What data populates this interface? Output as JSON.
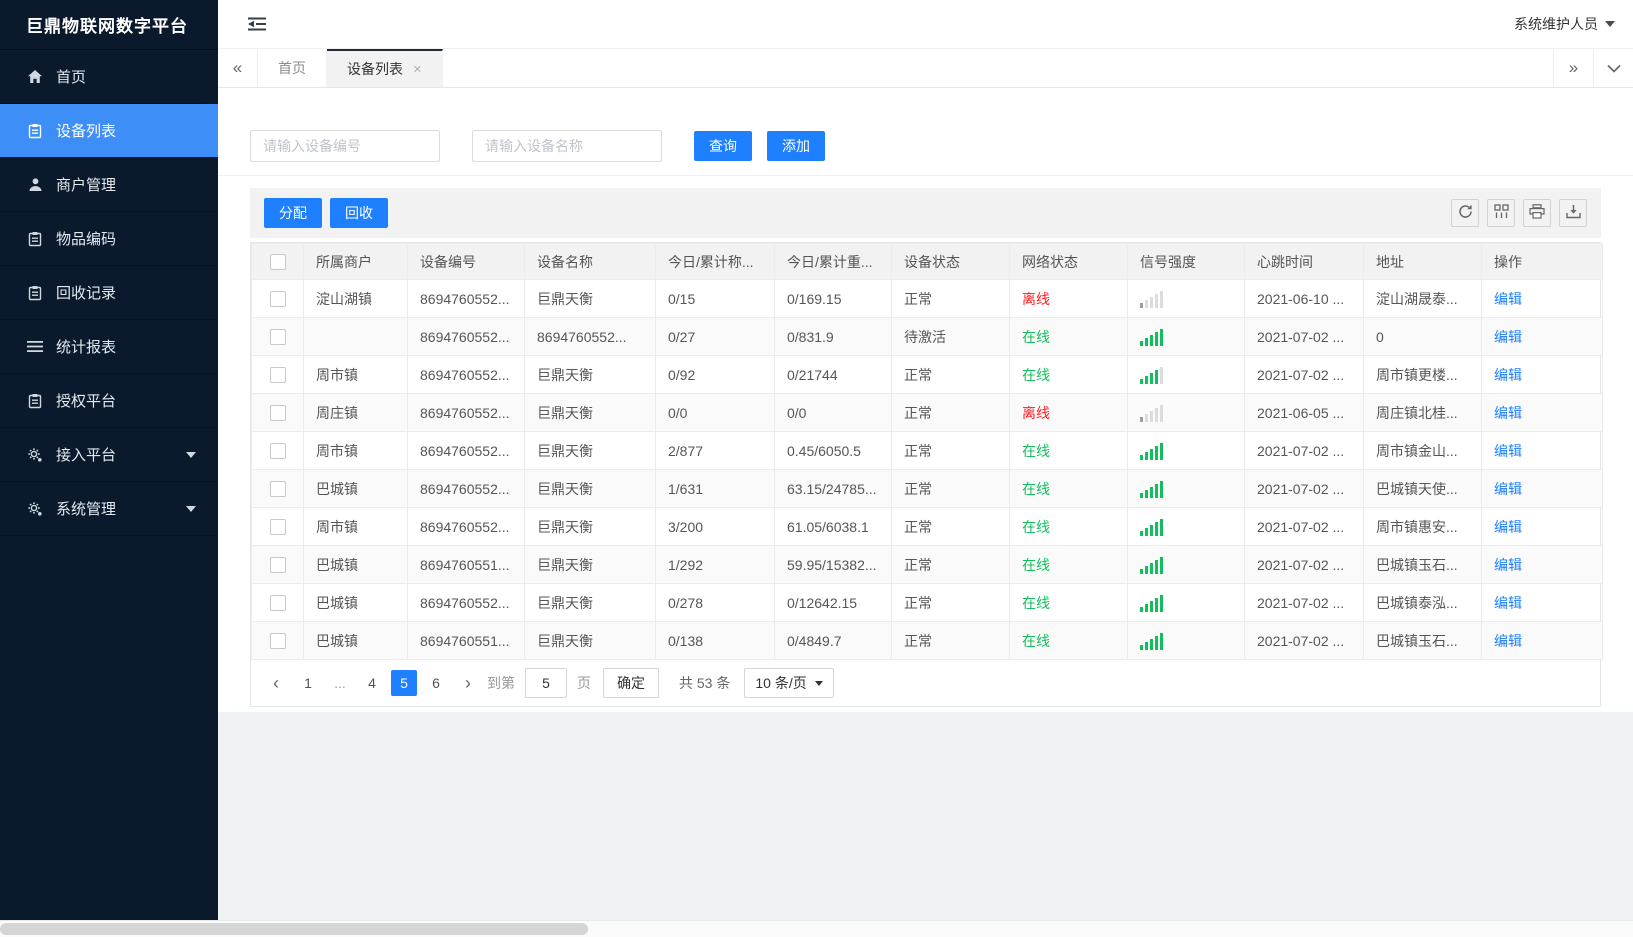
{
  "app": {
    "title": "巨鼎物联网数字平台",
    "user": "系统维护人员"
  },
  "colors": {
    "accent": "#1e80ff",
    "sidebar_active": "#3e8ef7",
    "online": "#13bf5c",
    "offline": "#ff1e1e"
  },
  "sidebar": {
    "items": [
      {
        "id": "home",
        "label": "首页",
        "icon": "home"
      },
      {
        "id": "device-list",
        "label": "设备列表",
        "icon": "doc",
        "active": true
      },
      {
        "id": "merchant-management",
        "label": "商户管理",
        "icon": "user"
      },
      {
        "id": "item-coding",
        "label": "物品编码",
        "icon": "doc"
      },
      {
        "id": "recycle-records",
        "label": "回收记录",
        "icon": "doc"
      },
      {
        "id": "statistics-report",
        "label": "统计报表",
        "icon": "lines"
      },
      {
        "id": "authorization-platform",
        "label": "授权平台",
        "icon": "doc"
      },
      {
        "id": "access-platform",
        "label": "接入平台",
        "icon": "gear",
        "expandable": true
      },
      {
        "id": "system-management",
        "label": "系统管理",
        "icon": "gear",
        "expandable": true
      }
    ]
  },
  "tabs": {
    "items": [
      {
        "id": "home",
        "label": "首页",
        "active": false,
        "closable": false
      },
      {
        "id": "device-list",
        "label": "设备列表",
        "active": true,
        "closable": true
      }
    ]
  },
  "search": {
    "device_no_placeholder": "请输入设备编号",
    "device_name_placeholder": "请输入设备名称",
    "query_label": "查询",
    "add_label": "添加"
  },
  "toolbar": {
    "assign_label": "分配",
    "recycle_label": "回收",
    "icons": [
      "refresh",
      "columns",
      "print",
      "export"
    ]
  },
  "table": {
    "columns": [
      "所属商户",
      "设备编号",
      "设备名称",
      "今日/累计称...",
      "今日/累计重...",
      "设备状态",
      "网络状态",
      "信号强度",
      "心跳时间",
      "地址",
      "操作"
    ],
    "action_label": "编辑",
    "rows": [
      {
        "merchant": "淀山湖镇",
        "device_no": "8694760552...",
        "device_name": "巨鼎天衡",
        "today_count": "0/15",
        "today_weight": "0/169.15",
        "status": "正常",
        "network": "离线",
        "online": false,
        "signal_level": 1,
        "heartbeat": "2021-06-10 ...",
        "address": "淀山湖晟泰..."
      },
      {
        "merchant": "",
        "device_no": "8694760552...",
        "device_name": "8694760552...",
        "today_count": "0/27",
        "today_weight": "0/831.9",
        "status": "待激活",
        "network": "在线",
        "online": true,
        "signal_level": 5,
        "heartbeat": "2021-07-02 ...",
        "address": "0"
      },
      {
        "merchant": "周市镇",
        "device_no": "8694760552...",
        "device_name": "巨鼎天衡",
        "today_count": "0/92",
        "today_weight": "0/21744",
        "status": "正常",
        "network": "在线",
        "online": true,
        "signal_level": 4,
        "heartbeat": "2021-07-02 ...",
        "address": "周市镇更楼..."
      },
      {
        "merchant": "周庄镇",
        "device_no": "8694760552...",
        "device_name": "巨鼎天衡",
        "today_count": "0/0",
        "today_weight": "0/0",
        "status": "正常",
        "network": "离线",
        "online": false,
        "signal_level": 1,
        "heartbeat": "2021-06-05 ...",
        "address": "周庄镇北桂..."
      },
      {
        "merchant": "周市镇",
        "device_no": "8694760552...",
        "device_name": "巨鼎天衡",
        "today_count": "2/877",
        "today_weight": "0.45/6050.5",
        "status": "正常",
        "network": "在线",
        "online": true,
        "signal_level": 5,
        "heartbeat": "2021-07-02 ...",
        "address": "周市镇金山..."
      },
      {
        "merchant": "巴城镇",
        "device_no": "8694760552...",
        "device_name": "巨鼎天衡",
        "today_count": "1/631",
        "today_weight": "63.15/24785...",
        "status": "正常",
        "network": "在线",
        "online": true,
        "signal_level": 5,
        "heartbeat": "2021-07-02 ...",
        "address": "巴城镇天使..."
      },
      {
        "merchant": "周市镇",
        "device_no": "8694760552...",
        "device_name": "巨鼎天衡",
        "today_count": "3/200",
        "today_weight": "61.05/6038.1",
        "status": "正常",
        "network": "在线",
        "online": true,
        "signal_level": 5,
        "heartbeat": "2021-07-02 ...",
        "address": "周市镇惠安..."
      },
      {
        "merchant": "巴城镇",
        "device_no": "8694760551...",
        "device_name": "巨鼎天衡",
        "today_count": "1/292",
        "today_weight": "59.95/15382...",
        "status": "正常",
        "network": "在线",
        "online": true,
        "signal_level": 5,
        "heartbeat": "2021-07-02 ...",
        "address": "巴城镇玉石..."
      },
      {
        "merchant": "巴城镇",
        "device_no": "8694760552...",
        "device_name": "巨鼎天衡",
        "today_count": "0/278",
        "today_weight": "0/12642.15",
        "status": "正常",
        "network": "在线",
        "online": true,
        "signal_level": 5,
        "heartbeat": "2021-07-02 ...",
        "address": "巴城镇泰泓..."
      },
      {
        "merchant": "巴城镇",
        "device_no": "8694760551...",
        "device_name": "巨鼎天衡",
        "today_count": "0/138",
        "today_weight": "0/4849.7",
        "status": "正常",
        "network": "在线",
        "online": true,
        "signal_level": 5,
        "heartbeat": "2021-07-02 ...",
        "address": "巴城镇玉石..."
      }
    ]
  },
  "pagination": {
    "prev": "‹",
    "next": "›",
    "pages": [
      "1",
      "...",
      "4",
      "5",
      "6"
    ],
    "active": "5",
    "goto_label": "到第",
    "goto_value": "5",
    "page_label": "页",
    "confirm_label": "确定",
    "total_label": "共 53 条",
    "page_size": "10 条/页"
  }
}
